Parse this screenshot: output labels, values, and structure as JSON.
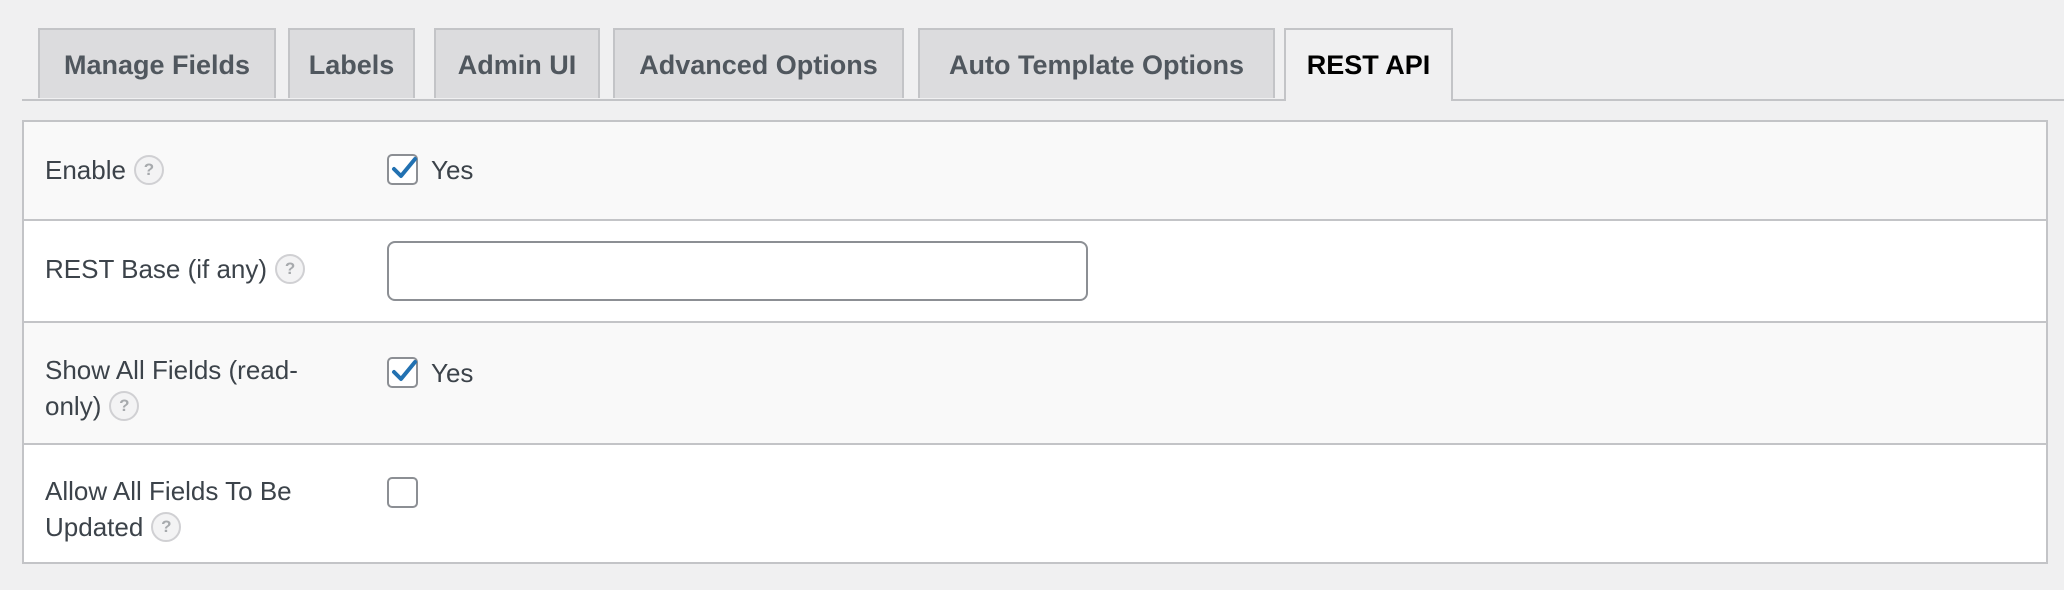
{
  "tabs": [
    {
      "label": "Manage Fields"
    },
    {
      "label": "Labels"
    },
    {
      "label": "Admin UI"
    },
    {
      "label": "Advanced Options"
    },
    {
      "label": "Auto Template Options"
    },
    {
      "label": "REST API"
    }
  ],
  "active_tab": "REST API",
  "help_icon_glyph": "?",
  "fields": {
    "enable": {
      "label": "Enable",
      "checked": true,
      "option_label": "Yes"
    },
    "rest_base": {
      "label": "REST Base (if any)",
      "value": "",
      "placeholder": ""
    },
    "show_all_fields": {
      "label": "Show All Fields (read-only)",
      "checked": true,
      "option_label": "Yes"
    },
    "allow_all_updated": {
      "label": "Allow All Fields To Be Updated",
      "checked": false
    }
  },
  "colors": {
    "accent": "#2271b1",
    "border": "#c3c4c7",
    "background": "#f0f0f1"
  }
}
